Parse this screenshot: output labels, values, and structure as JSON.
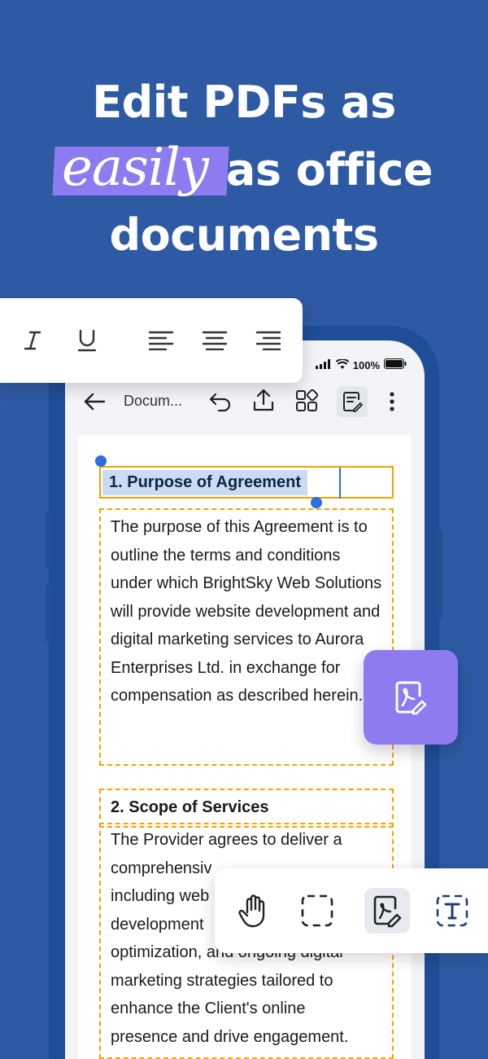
{
  "headline": {
    "line1": "Edit PDFs as",
    "highlight": "easily",
    "line2_rest": "as office",
    "line3": "documents"
  },
  "status_bar": {
    "battery_percent": "100%"
  },
  "toolbar": {
    "doc_title": "Docum..."
  },
  "document": {
    "section1": {
      "heading": "1. Purpose of Agreement",
      "body": "The purpose of this Agreement is to outline the terms and conditions under which BrightSky Web Solutions will provide website development and digital marketing services to Aurora Enterprises Ltd. in exchange for compensation as described herein."
    },
    "section2": {
      "heading": "2. Scope of Services",
      "lines": [
        "The Provider agrees to deliver a",
        "comprehensiv",
        "including web",
        "development",
        "optimization, and ongoing digital",
        "marketing strategies tailored to",
        "enhance the Client's online",
        "presence and drive engagement."
      ]
    }
  },
  "format_bar": {
    "items": [
      "italic-icon",
      "underline-icon",
      "align-left-icon",
      "align-center-icon",
      "align-right-icon"
    ]
  },
  "tool_bar": {
    "items": [
      "hand-icon",
      "select-area-icon",
      "edit-pdf-icon",
      "text-box-icon"
    ],
    "active": "edit-pdf-icon"
  },
  "colors": {
    "background": "#2e5aa3",
    "accent_purple": "#8d7cf0",
    "selection_orange": "#f0a500",
    "handle_blue": "#2b6fe0"
  }
}
